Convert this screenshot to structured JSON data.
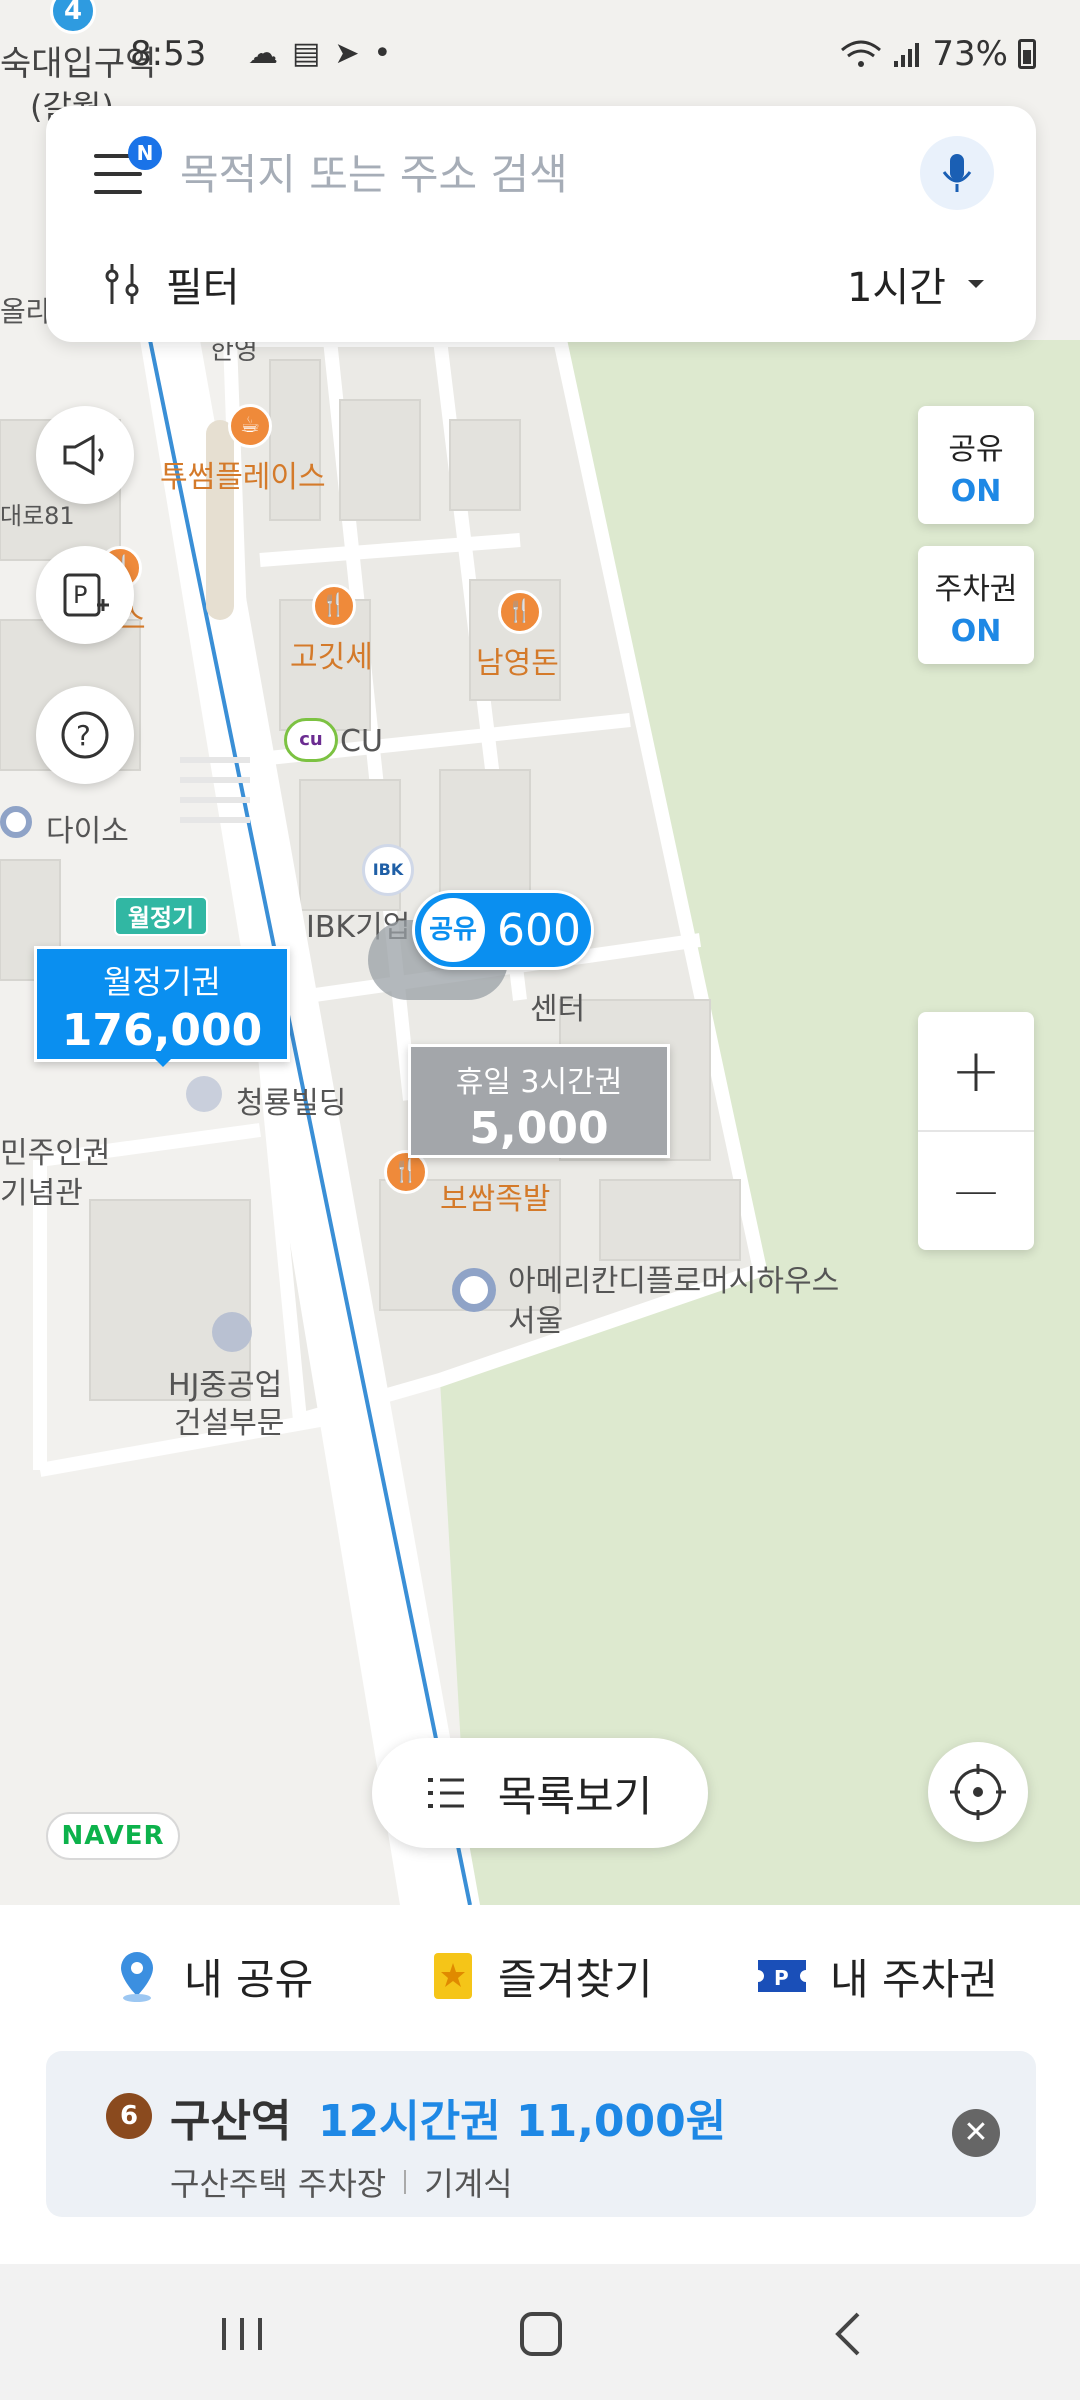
{
  "status": {
    "time": "8:53",
    "battery": "73%",
    "icons": [
      "cloud-icon",
      "calendar-icon",
      "send-icon",
      "dot-icon"
    ]
  },
  "search": {
    "placeholder": "목적지 또는 주소 검색",
    "badge": "N",
    "filter_label": "필터",
    "duration": "1시간"
  },
  "toggles": [
    {
      "label": "공유",
      "value": "ON"
    },
    {
      "label": "주차권",
      "value": "ON"
    }
  ],
  "zoom": {
    "plus": "+",
    "minus": "—"
  },
  "map": {
    "station_top": "숙대입구역",
    "station_top2": "(갈월)",
    "station_badge": "4",
    "pois": {
      "twosome": "투썸플레이스",
      "goat": "고깃세",
      "namyeong": "남영돈",
      "cu": "CU",
      "daiso": "다이소",
      "ibk": "IBK기업",
      "center": "센터",
      "cheongryong": "청룡빌딩",
      "minju": "민주인권",
      "minju2": "기념관",
      "bossam": "보쌈족발",
      "american": "아메리칸디플로머시하우스",
      "american2": "서울",
      "hj": "HJ중공업",
      "hj2": "건설부문",
      "ssx": "스",
      "ol": "올라",
      "daero": "대로81",
      "hanyeong": "한영"
    },
    "monthly_tag": "월정기",
    "monthly_label": "월정기권",
    "monthly_price": "176,000",
    "share_chip": "공유",
    "share_price": "600",
    "holiday_label": "휴일 3시간권",
    "holiday_price": "5,000",
    "naver": "NAVER"
  },
  "list_button": "목록보기",
  "bottom_tabs": [
    {
      "label": "내 공유"
    },
    {
      "label": "즐겨찾기"
    },
    {
      "label": "내 주차권"
    }
  ],
  "info_card": {
    "number": "6",
    "station": "구산역",
    "ticket": "12시간권 11,000원",
    "lot": "구산주택 주차장",
    "type": "기계식"
  },
  "colors": {
    "accent": "#0a8ff0",
    "teal": "#31b7a3",
    "park_green": "#dde9cf",
    "poi_orange": "#d47a2a"
  }
}
